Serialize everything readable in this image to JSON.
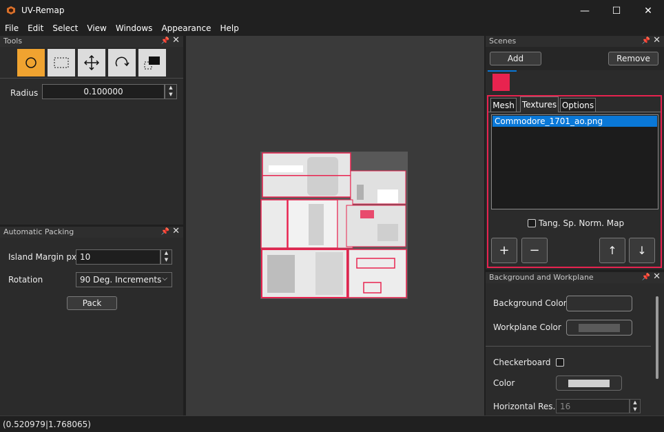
{
  "window": {
    "title": "UV-Remap",
    "minimize": "—",
    "maximize": "☐",
    "close": "✕"
  },
  "menu": [
    "File",
    "Edit",
    "Select",
    "View",
    "Windows",
    "Appearance",
    "Help"
  ],
  "tools_panel": {
    "title": "Tools",
    "radius_label": "Radius",
    "radius_value": "0.100000"
  },
  "packing_panel": {
    "title": "Automatic Packing",
    "margin_label": "Island Margin px.",
    "margin_value": "10",
    "rotation_label": "Rotation",
    "rotation_value": "90 Deg. Increments",
    "pack_label": "Pack"
  },
  "scenes_panel": {
    "title": "Scenes",
    "add_label": "Add",
    "remove_label": "Remove",
    "scene_color": "#e8234f",
    "tabs": [
      "Mesh",
      "Textures",
      "Options"
    ],
    "active_tab": "Textures",
    "textures": [
      "Commodore_1701_ao.png"
    ],
    "tangent_label": "Tang. Sp. Norm. Map",
    "plus": "+",
    "minus": "−",
    "up": "↑",
    "down": "↓"
  },
  "bg_panel": {
    "title": "Background and Workplane",
    "bg_color_label": "Background Color",
    "workplane_color_label": "Workplane Color",
    "checkerboard_label": "Checkerboard",
    "color_label": "Color",
    "hres_label": "Horizontal Res.",
    "hres_value": "16"
  },
  "status": {
    "coords": "(0.520979|1.768065)"
  },
  "colors": {
    "accent": "#e8234f",
    "selection": "#0a78d7"
  }
}
